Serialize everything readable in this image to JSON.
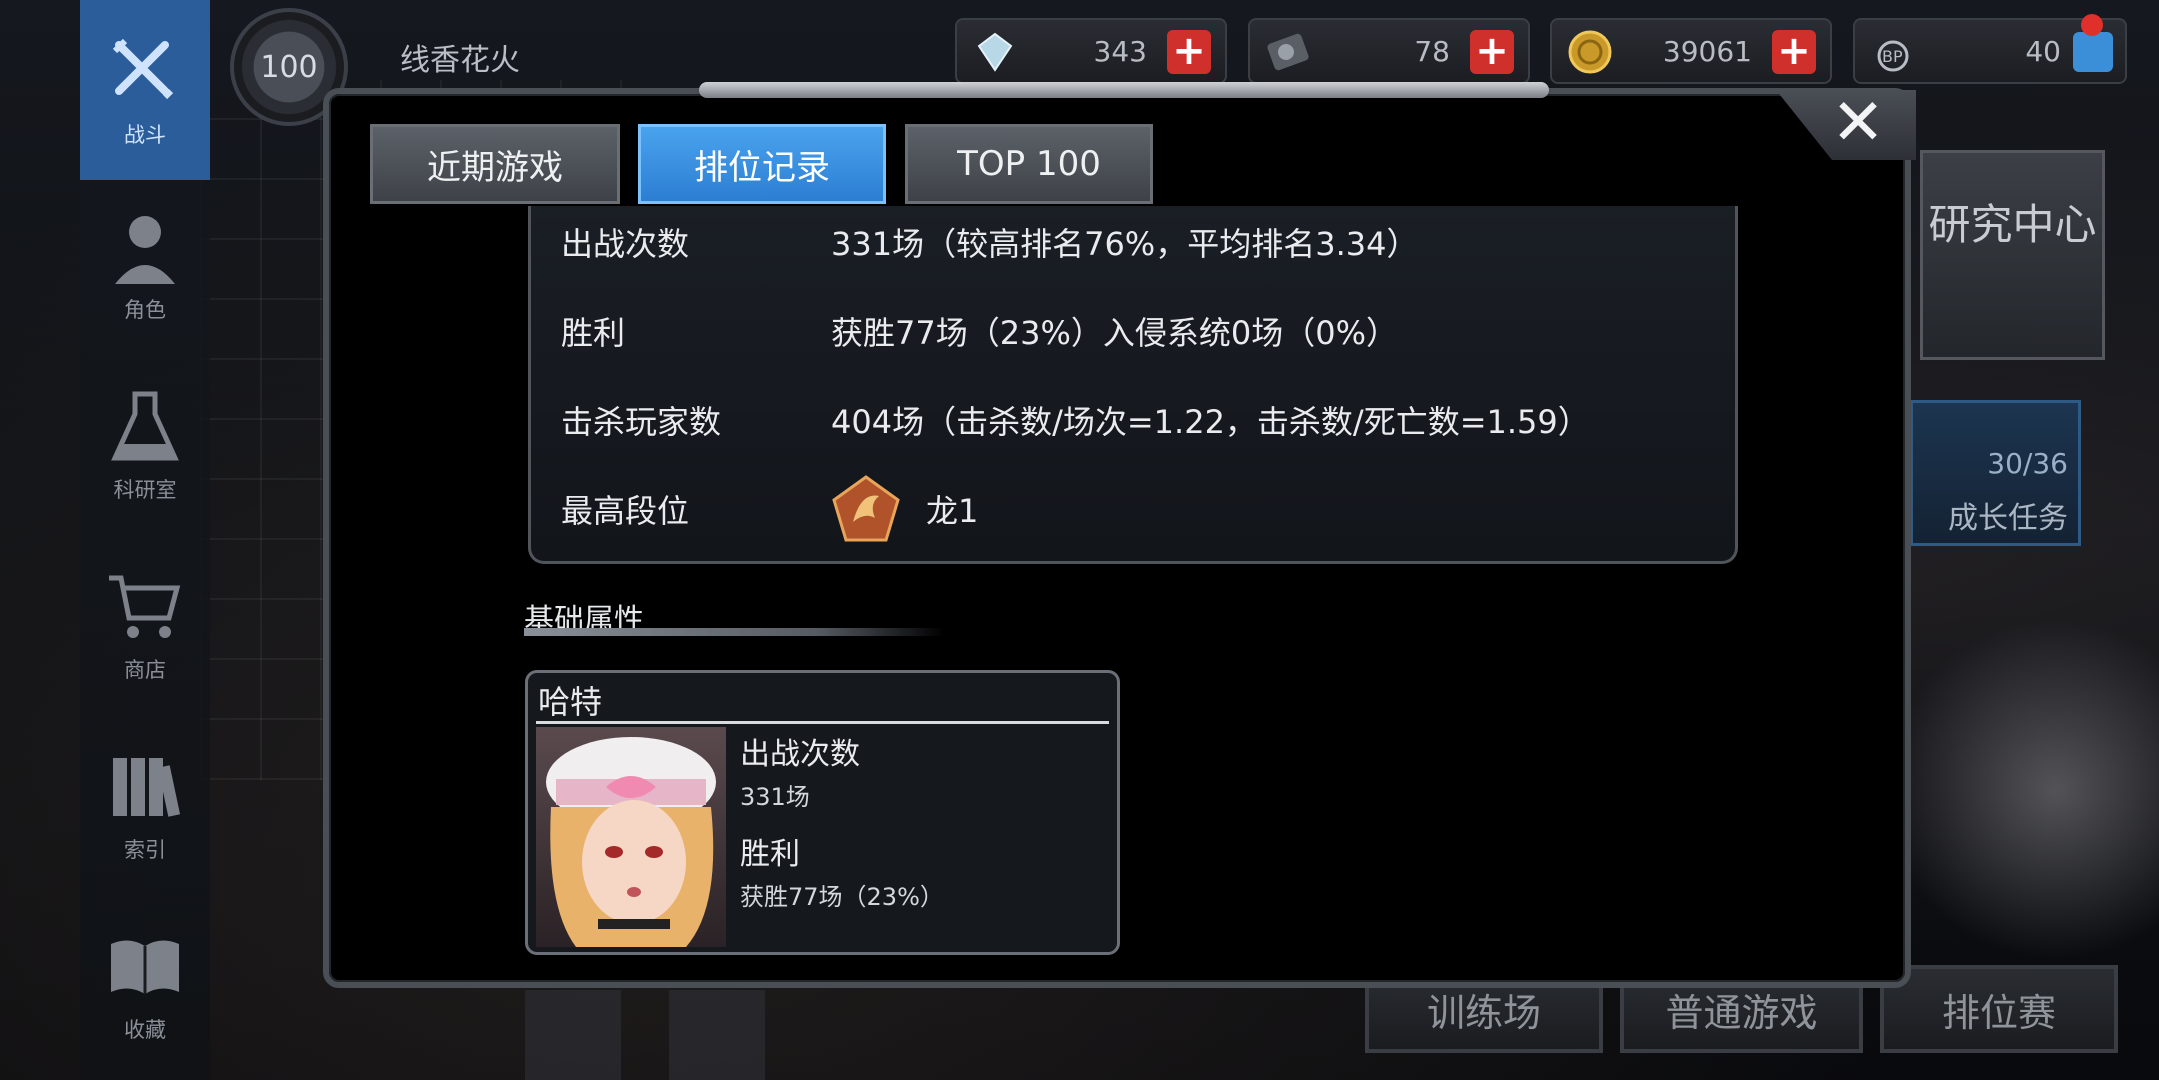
{
  "sidebar": {
    "items": [
      {
        "label": "战斗",
        "icon": "crossed-weapons-icon",
        "active": true
      },
      {
        "label": "角色",
        "icon": "character-bust-icon"
      },
      {
        "label": "科研室",
        "icon": "flask-icon"
      },
      {
        "label": "商店",
        "icon": "cart-icon"
      },
      {
        "label": "索引",
        "icon": "books-icon"
      },
      {
        "label": "收藏",
        "icon": "open-book-icon"
      }
    ]
  },
  "player": {
    "level": "100",
    "name": "线香花火"
  },
  "resources": [
    {
      "icon": "crystal-icon",
      "value": "343"
    },
    {
      "icon": "disc-icon",
      "value": "78"
    },
    {
      "icon": "gold-coin-icon",
      "value": "39061"
    },
    {
      "icon": "bp-paw-icon",
      "value": "40"
    }
  ],
  "right_panel": {
    "research": "研究中心",
    "growth": {
      "count": "30/36",
      "label": "成长任务"
    },
    "bottom_buttons": [
      "训练场",
      "普通游戏",
      "排位赛"
    ]
  },
  "modal": {
    "close_symbol": "✕",
    "tabs": [
      {
        "label": "近期游戏",
        "active": false
      },
      {
        "label": "排位记录",
        "active": true
      },
      {
        "label": "TOP 100",
        "active": false
      }
    ],
    "stats": [
      {
        "key": "出战次数",
        "value": "331场（较高排名76%，平均排名3.34）"
      },
      {
        "key": "胜利",
        "value": "获胜77场（23%）入侵系统0场（0%）"
      },
      {
        "key": "击杀玩家数",
        "value": "404场（击杀数/场次=1.22，击杀数/死亡数=1.59）"
      },
      {
        "key": "最高段位",
        "value": "龙1"
      }
    ],
    "section_title": "基础属性",
    "character": {
      "name": "哈特",
      "fields": [
        {
          "label": "出战次数",
          "value": "331场"
        },
        {
          "label": "胜利",
          "value": "获胜77场（23%）"
        }
      ]
    }
  }
}
